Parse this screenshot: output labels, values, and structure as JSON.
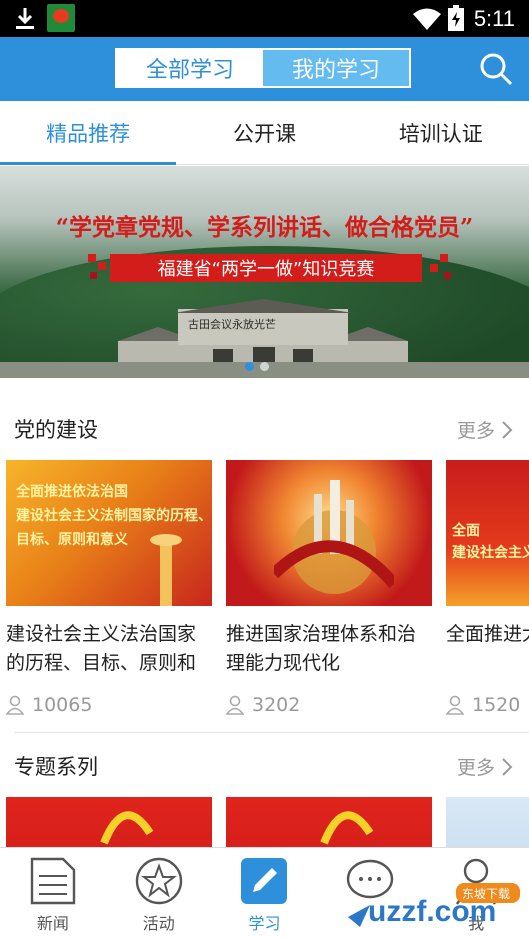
{
  "status_bar": {
    "time": "5:11"
  },
  "header": {
    "segments": [
      {
        "label": "全部学习",
        "active": true
      },
      {
        "label": "我的学习",
        "active": false
      }
    ],
    "accent_color": "#2e90da"
  },
  "tabs": [
    {
      "label": "精品推荐",
      "active": true
    },
    {
      "label": "公开课",
      "active": false
    },
    {
      "label": "培训认证",
      "active": false
    }
  ],
  "banner": {
    "slogan": "“学党章党规、学系列讲话、做合格党员”",
    "subtitle": "福建省“两学一做”知识竞赛",
    "sign": "古田会议永放光芒",
    "active_dot": 1,
    "dot_count": 2
  },
  "sections": [
    {
      "title": "党的建设",
      "more": "更多",
      "cards": [
        {
          "thumb_text": "全面推进依法治国\n建设社会主义法制国家的历程、\n目标、原则和意义",
          "title": "建设社会主义法治国家的历程、目标、原则和",
          "views": "10065"
        },
        {
          "thumb_text": "",
          "title": "推进国家治理体系和治理能力现代化",
          "views": "3202"
        },
        {
          "thumb_text": "全面\n建设社会主义",
          "title": "全面推进大任务",
          "views": "1520"
        }
      ]
    },
    {
      "title": "专题系列",
      "more": "更多"
    }
  ],
  "bottom_nav": [
    {
      "label": "新闻",
      "icon": "document-icon",
      "active": false
    },
    {
      "label": "活动",
      "icon": "star-icon",
      "active": false
    },
    {
      "label": "学习",
      "icon": "pencil-icon",
      "active": true
    },
    {
      "label": "",
      "icon": "chat-icon",
      "active": false
    },
    {
      "label": "我",
      "icon": "person-icon",
      "active": false
    }
  ],
  "watermark": {
    "text": "uzzf.com",
    "badge": "东坡下载"
  }
}
